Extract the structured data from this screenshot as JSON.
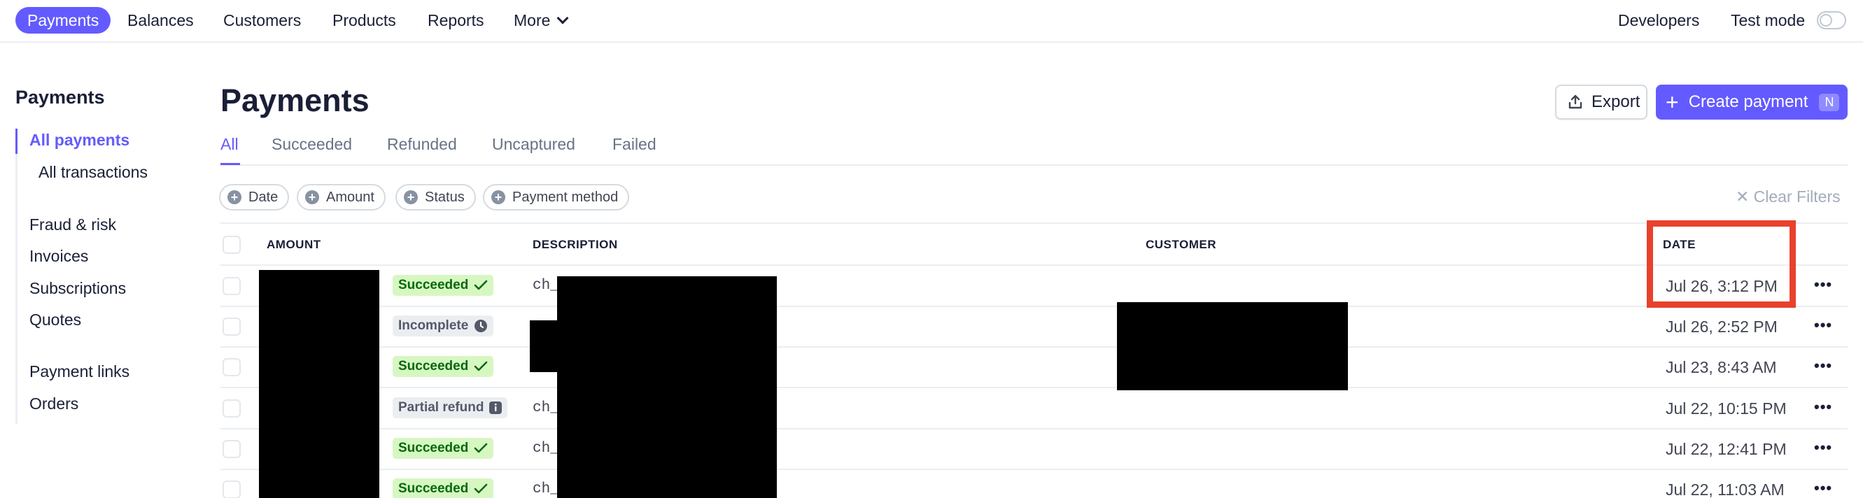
{
  "nav": {
    "items": [
      "Payments",
      "Balances",
      "Customers",
      "Products",
      "Reports"
    ],
    "more_label": "More",
    "developers_label": "Developers",
    "test_mode_label": "Test mode"
  },
  "sidebar": {
    "title": "Payments",
    "items": [
      "All payments",
      "All transactions",
      "Fraud & risk",
      "Invoices",
      "Subscriptions",
      "Quotes",
      "Payment links",
      "Orders"
    ]
  },
  "header": {
    "title": "Payments",
    "export_label": "Export",
    "create_label": "Create payment",
    "create_shortcut": "N"
  },
  "tabs": [
    "All",
    "Succeeded",
    "Refunded",
    "Uncaptured",
    "Failed"
  ],
  "filters": {
    "chips": [
      "Date",
      "Amount",
      "Status",
      "Payment method"
    ],
    "clear_label": "Clear Filters"
  },
  "table": {
    "headers": [
      "AMOUNT",
      "DESCRIPTION",
      "CUSTOMER",
      "DATE"
    ],
    "rows": [
      {
        "status": "Succeeded",
        "status_icon": "check-icon",
        "desc": "ch_",
        "date": "Jul 26, 3:12 PM"
      },
      {
        "status": "Incomplete",
        "status_icon": "clock-icon",
        "desc": "",
        "date": "Jul 26, 2:52 PM"
      },
      {
        "status": "Succeeded",
        "status_icon": "check-icon",
        "desc": "",
        "date": "Jul 23, 8:43 AM"
      },
      {
        "status": "Partial refund",
        "status_icon": "info-icon",
        "desc": "ch_",
        "date": "Jul 22, 10:15 PM"
      },
      {
        "status": "Succeeded",
        "status_icon": "check-icon",
        "desc": "ch_",
        "date": "Jul 22, 12:41 PM"
      },
      {
        "status": "Succeeded",
        "status_icon": "check-icon",
        "desc": "ch_",
        "date": "Jul 22, 11:03 AM"
      }
    ]
  },
  "colors": {
    "accent": "#635bff",
    "success_bg": "#d7f7c2",
    "success_text": "#05690d",
    "highlight": "#e8412c"
  }
}
